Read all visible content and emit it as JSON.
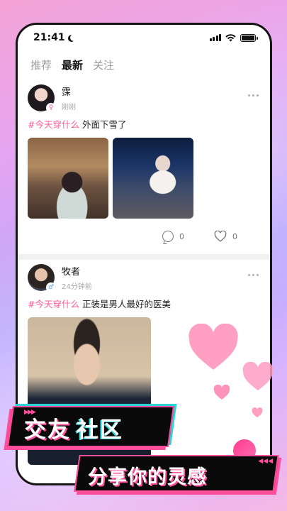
{
  "status_bar": {
    "time": "21:41"
  },
  "tabs": [
    {
      "label": "推荐",
      "active": false
    },
    {
      "label": "最新",
      "active": true
    },
    {
      "label": "关注",
      "active": false
    }
  ],
  "posts": [
    {
      "username": "霂",
      "time": "刚刚",
      "gender": "female",
      "hashtag": "#今天穿什么",
      "caption": "外面下雪了",
      "comments": "0",
      "likes": "0",
      "images": [
        "cafe-photo",
        "snow-street-photo"
      ]
    },
    {
      "username": "牧者",
      "time": "24分钟前",
      "gender": "male",
      "hashtag": "#今天穿什么",
      "caption": "正装是男人最好的医美",
      "images": [
        "suit-portrait-photo"
      ]
    }
  ],
  "banner": {
    "line1_part1": "交友",
    "line1_part2": "社区",
    "line2": "分享你的灵感"
  },
  "colors": {
    "accent_pink": "#ff4e9c",
    "hashtag_pink": "#ff5c93",
    "accent_cyan": "#2ad4d9"
  },
  "icons": {
    "gender_female": "♀",
    "gender_male": "♂",
    "deco_arrows": "▶▶▶",
    "deco_arrows_2": "◀◀◀"
  }
}
